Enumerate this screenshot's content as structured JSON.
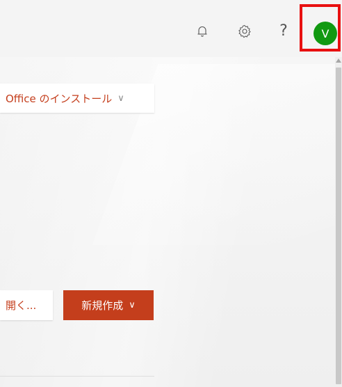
{
  "header": {
    "notifications_icon": "bell-icon",
    "settings_icon": "gear-icon",
    "help_glyph": "?",
    "avatar_initial": "V"
  },
  "main": {
    "install_office_label": "Office のインストール",
    "open_label": "開く...",
    "new_label": "新規作成",
    "dropdown_caret": "∨"
  },
  "colors": {
    "accent": "#c43e1c",
    "avatar_bg": "#119911",
    "highlight": "#e81010"
  }
}
